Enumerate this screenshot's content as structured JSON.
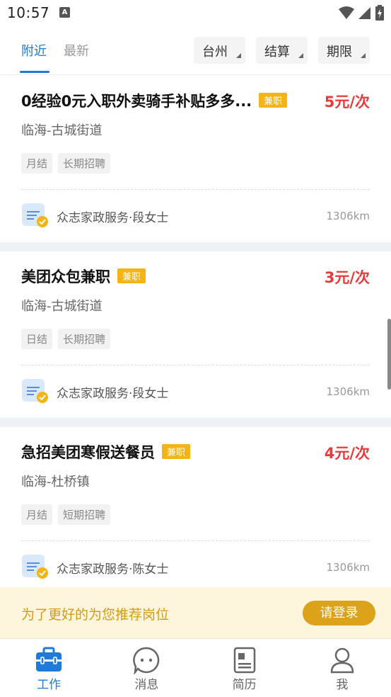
{
  "status_bar": {
    "time": "10:57",
    "notification": "A"
  },
  "tabs": {
    "nearby": "附近",
    "latest": "最新"
  },
  "filters": {
    "city": "台州",
    "settlement": "结算",
    "term": "期限"
  },
  "jobs": [
    {
      "title": "0经验0元入职外卖骑手补贴多多...",
      "badge": "兼职",
      "price": "5元/次",
      "location": "临海-古城街道",
      "tags": [
        "月结",
        "长期招聘"
      ],
      "company": "众志家政服务·段女士",
      "distance": "1306km"
    },
    {
      "title": "美团众包兼职",
      "badge": "兼职",
      "price": "3元/次",
      "location": "临海-古城街道",
      "tags": [
        "日结",
        "长期招聘"
      ],
      "company": "众志家政服务·段女士",
      "distance": "1306km"
    },
    {
      "title": "急招美团寒假送餐员",
      "badge": "兼职",
      "price": "4元/次",
      "location": "临海-杜桥镇",
      "tags": [
        "月结",
        "短期招聘"
      ],
      "company": "众志家政服务·陈女士",
      "distance": "1306km"
    }
  ],
  "login_banner": {
    "text": "为了更好的为您推荐岗位",
    "button": "请登录"
  },
  "bottom_nav": [
    {
      "label": "工作",
      "icon": "briefcase-icon",
      "active": true
    },
    {
      "label": "消息",
      "icon": "chat-icon",
      "active": false
    },
    {
      "label": "简历",
      "icon": "resume-icon",
      "active": false
    },
    {
      "label": "我",
      "icon": "person-icon",
      "active": false
    }
  ],
  "colors": {
    "accent": "#1f7ad8",
    "price": "#e83a3a",
    "badge": "#f5b415",
    "login": "#dba21a"
  }
}
